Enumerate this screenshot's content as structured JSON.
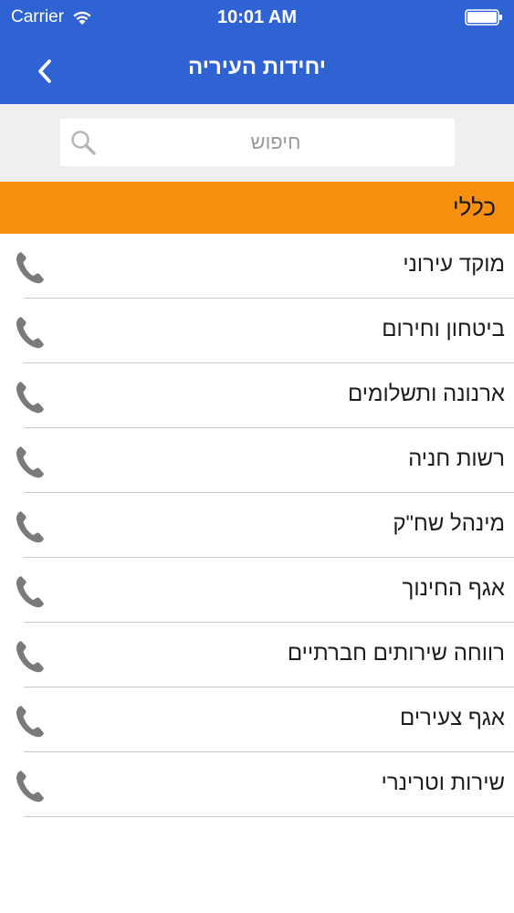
{
  "status_bar": {
    "carrier": "Carrier",
    "time": "10:01 AM",
    "icons": [
      "wifi-icon",
      "battery-icon"
    ]
  },
  "nav": {
    "title": "יחידות העיריה",
    "back_icon": "chevron-left-icon"
  },
  "search": {
    "placeholder": "חיפוש",
    "value": "",
    "icon": "search-icon"
  },
  "section": {
    "title": "כללי"
  },
  "items": [
    {
      "label": "מוקד עירוני",
      "icon": "phone-icon"
    },
    {
      "label": "ביטחון וחירום",
      "icon": "phone-icon"
    },
    {
      "label": "ארנונה ותשלומים",
      "icon": "phone-icon"
    },
    {
      "label": "רשות חניה",
      "icon": "phone-icon"
    },
    {
      "label": "מינהל שח\"ק",
      "icon": "phone-icon"
    },
    {
      "label": "אגף החינוך",
      "icon": "phone-icon"
    },
    {
      "label": "רווחה שירותים חברתיים",
      "icon": "phone-icon"
    },
    {
      "label": "אגף צעירים",
      "icon": "phone-icon"
    },
    {
      "label": "שירות וטרינרי",
      "icon": "phone-icon"
    }
  ],
  "colors": {
    "header_blue": "#2f63d4",
    "section_orange": "#f6900e",
    "search_bg": "#efefef",
    "icon_gray": "#7a7a7a"
  }
}
